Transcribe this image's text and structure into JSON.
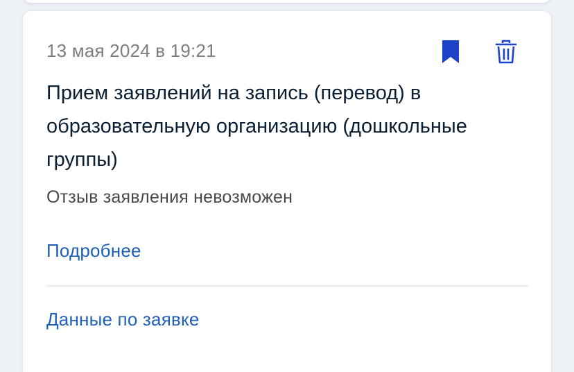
{
  "application": {
    "date": "13 мая 2024 в 19:21",
    "title": "Прием заявлений на запись (перевод) в образовательную организацию (дошкольные группы)",
    "status": "Отзыв заявления невозможен",
    "details_link": "Подробнее",
    "request_data_link": "Данные по заявке",
    "actions": {
      "bookmark_icon": "bookmark-icon",
      "delete_icon": "trash-icon"
    }
  },
  "colors": {
    "accent": "#1d43c8",
    "link": "#2160b8",
    "title": "#0b1f33",
    "secondary_text": "#7a7d82",
    "status_text": "#45494e",
    "background": "#eef1f5",
    "card": "#ffffff"
  }
}
